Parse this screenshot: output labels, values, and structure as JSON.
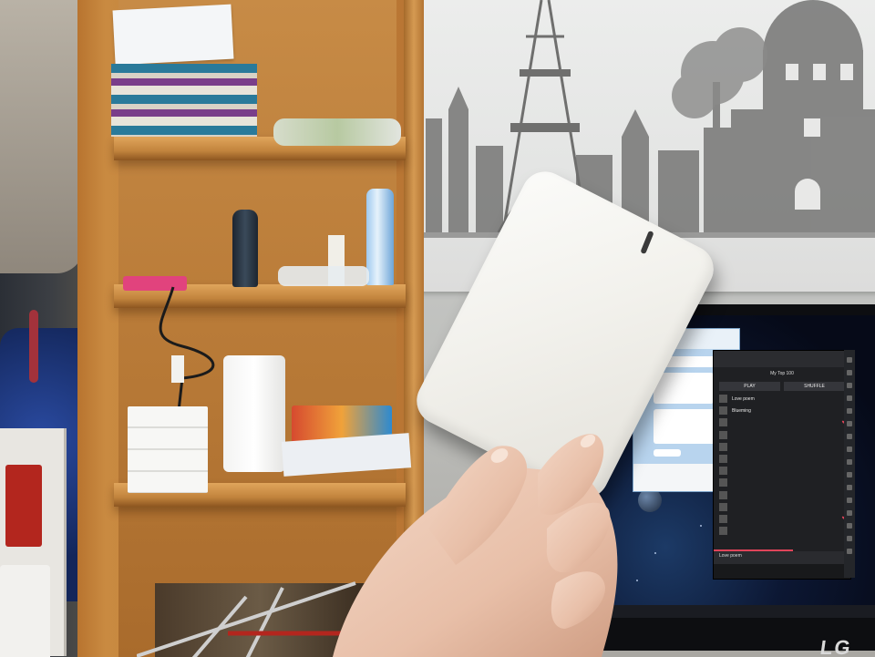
{
  "scene": {
    "objects": [
      {
        "name": "wooden-bookshelf"
      },
      {
        "name": "paris-skyline-poster"
      },
      {
        "name": "white-power-bank"
      },
      {
        "name": "hand"
      },
      {
        "name": "computer-monitor"
      },
      {
        "name": "chat-window"
      },
      {
        "name": "music-player-window"
      },
      {
        "name": "drying-rack"
      }
    ]
  },
  "monitor": {
    "brand": "LG"
  },
  "music_app": {
    "header": "My Top 100",
    "play_label": "PLAY",
    "shuffle_label": "SHUFFLE",
    "tracks": [
      {
        "title": "Love poem",
        "liked": false
      },
      {
        "title": "Blueming",
        "liked": false
      },
      {
        "title": "",
        "liked": true
      },
      {
        "title": "",
        "liked": false
      },
      {
        "title": "",
        "liked": false
      },
      {
        "title": "",
        "liked": false
      },
      {
        "title": "",
        "liked": false
      },
      {
        "title": "",
        "liked": false
      },
      {
        "title": "",
        "liked": false
      },
      {
        "title": "",
        "liked": false
      },
      {
        "title": "",
        "liked": true
      },
      {
        "title": "",
        "liked": false
      }
    ],
    "now_playing": "Love poem"
  },
  "colors": {
    "shelf_wood": "#c1833d",
    "power_bank": "#f2f1ec",
    "screen_bg": "#0c1733",
    "chat_bg": "#b8d4ee",
    "app_accent": "#e0445a"
  }
}
